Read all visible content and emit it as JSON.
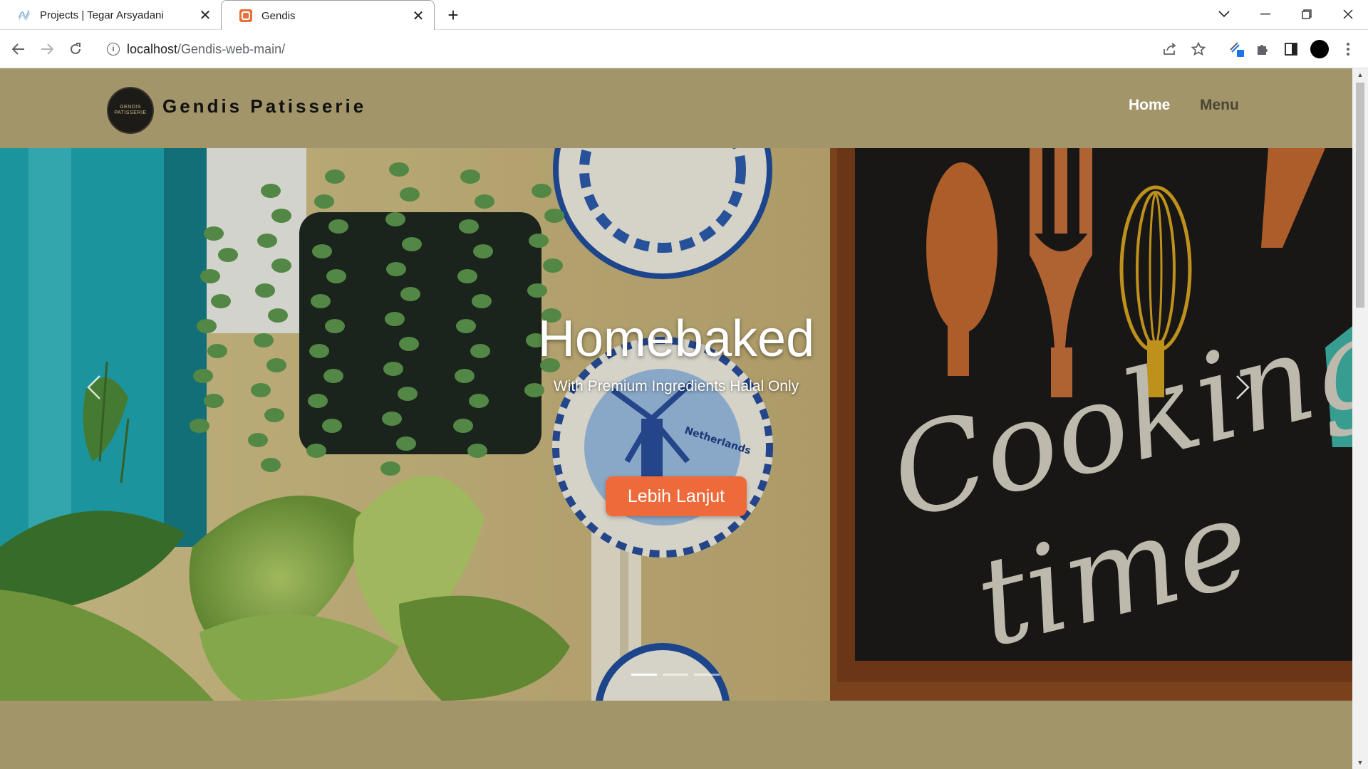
{
  "browser": {
    "tabs": [
      {
        "title": "Projects | Tegar Arsyadani",
        "active": false
      },
      {
        "title": "Gendis",
        "active": true
      }
    ],
    "url_host": "localhost",
    "url_path": "/Gendis-web-main/"
  },
  "site": {
    "brand": "Gendis Patisserie",
    "logo_text_line1": "GENDIS",
    "logo_text_line2": "PATISSERIE",
    "nav": [
      {
        "label": "Home",
        "active": true
      },
      {
        "label": "Menu",
        "active": false
      }
    ]
  },
  "hero": {
    "title": "Homebaked",
    "subtitle": "With Premium Ingredients Halal Only",
    "cta_label": "Lebih Lanjut",
    "slide_count": 3,
    "active_slide": 1,
    "board_text_line1": "Cooking",
    "board_text_line2": "time",
    "plate_text": "Netherlands"
  },
  "colors": {
    "header_bg": "#a3956a",
    "cta_bg": "#ee6a3a",
    "nav_active": "#ffffff",
    "nav_inactive": "#4a4535"
  }
}
